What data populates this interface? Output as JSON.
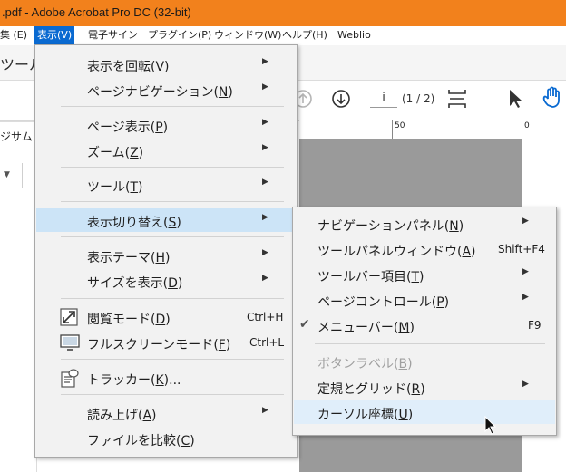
{
  "window": {
    "title": ".pdf - Adobe Acrobat Pro DC (32-bit)"
  },
  "menubar": [
    "集 (E)",
    "表示(V)",
    "電子サイン",
    "プラグイン(P)",
    "ウィンドウ(W)",
    "ヘルプ(H)",
    "Weblio"
  ],
  "app": {
    "tools_tab": "ツール",
    "left_text": "ジサム",
    "page_field": "i",
    "page_count": "(1 / 2)",
    "ruler_labels": [
      "50",
      "0"
    ]
  },
  "view_menu": {
    "items": [
      {
        "label": "表示を回転",
        "key": "V",
        "submenu": true
      },
      {
        "label": "ページナビゲーション",
        "key": "N",
        "submenu": true
      },
      {
        "label": "ページ表示",
        "key": "P",
        "submenu": true
      },
      {
        "label": "ズーム",
        "key": "Z",
        "submenu": true
      },
      {
        "label": "ツール",
        "key": "T",
        "submenu": true
      },
      {
        "label": "表示切り替え",
        "key": "S",
        "submenu": true,
        "highlighted": true
      },
      {
        "label": "表示テーマ",
        "key": "H",
        "submenu": true
      },
      {
        "label": "サイズを表示",
        "key": "D",
        "submenu": true
      },
      {
        "label": "閲覧モード",
        "key": "D",
        "shortcut": "Ctrl+H",
        "icon": "expand-icon"
      },
      {
        "label": "フルスクリーンモード",
        "key": "F",
        "shortcut": "Ctrl+L",
        "icon": "monitor-icon"
      },
      {
        "label": "トラッカー",
        "key": "K",
        "suffix": "...",
        "icon": "tracker-icon"
      },
      {
        "label": "読み上げ",
        "key": "A",
        "submenu": true
      },
      {
        "label": "ファイルを比較",
        "key": "C"
      }
    ]
  },
  "switch_submenu": {
    "items": [
      {
        "label": "ナビゲーションパネル",
        "key": "N",
        "submenu": true
      },
      {
        "label": "ツールパネルウィンドウ",
        "key": "A",
        "shortcut": "Shift+F4"
      },
      {
        "label": "ツールバー項目",
        "key": "T",
        "submenu": true
      },
      {
        "label": "ページコントロール",
        "key": "P",
        "submenu": true
      },
      {
        "label": "メニューバー",
        "key": "M",
        "shortcut": "F9",
        "checked": true
      },
      {
        "label": "ボタンラベル",
        "key": "B",
        "disabled": true
      },
      {
        "label": "定規とグリッド",
        "key": "R",
        "submenu": true
      },
      {
        "label": "カーソル座標",
        "key": "U",
        "hovered": true
      }
    ]
  },
  "colors": {
    "titlebar": "#f2811c",
    "menu_active": "#0a6ad1",
    "highlight": "#cce4f7"
  }
}
